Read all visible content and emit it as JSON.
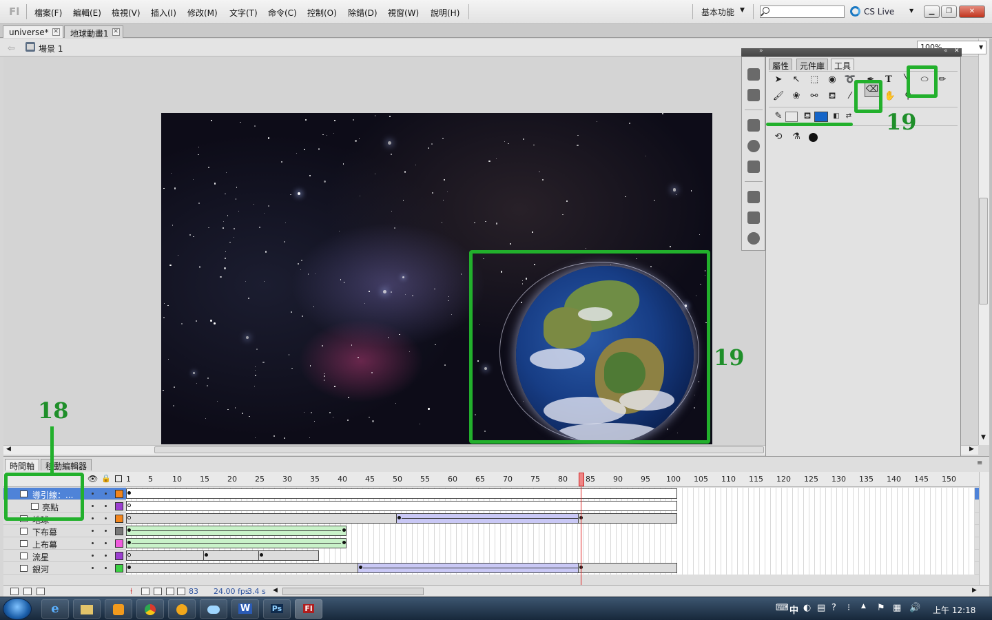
{
  "app": {
    "logo": "Fl"
  },
  "menus": [
    "檔案(F)",
    "編輯(E)",
    "檢視(V)",
    "插入(I)",
    "修改(M)",
    "文字(T)",
    "命令(C)",
    "控制(O)",
    "除錯(D)",
    "視窗(W)",
    "說明(H)"
  ],
  "workspace": {
    "label": "基本功能"
  },
  "search": {
    "placeholder": ""
  },
  "cs_live": "CS Live",
  "tabs": [
    {
      "label": "universe*"
    },
    {
      "label": "地球動畫1"
    }
  ],
  "editbar": {
    "scene_label": "場景 1",
    "zoom": "100%"
  },
  "panel": {
    "tabs": [
      "屬性",
      "元件庫",
      "工具"
    ],
    "active_tab": "工具",
    "text_tool_glyph": "T"
  },
  "annotations": {
    "layer_box_number": "18",
    "eraser_number": "19",
    "earth_box_number": "19",
    "color": "#22b02c"
  },
  "timeline": {
    "tabs": [
      "時間軸",
      "移動編輯器"
    ],
    "frame_labels": [
      "1",
      "5",
      "10",
      "15",
      "20",
      "25",
      "30",
      "35",
      "40",
      "45",
      "50",
      "55",
      "60",
      "65",
      "70",
      "75",
      "80",
      "85",
      "90",
      "95",
      "100",
      "105",
      "110",
      "115",
      "120",
      "125",
      "130",
      "135",
      "140",
      "145",
      "150"
    ],
    "current_frame": "83",
    "fps": "24.00 fps",
    "time": "3.4 s",
    "layers": [
      {
        "name": "導引線：...",
        "color": "#f2851c",
        "selected": true
      },
      {
        "name": "亮點",
        "color": "#9b3fd0"
      },
      {
        "name": "地球",
        "color": "#f2851c"
      },
      {
        "name": "下布幕",
        "color": "#777777"
      },
      {
        "name": "上布幕",
        "color": "#f05adc"
      },
      {
        "name": "流星",
        "color": "#9b3fd0"
      },
      {
        "name": "銀河",
        "color": "#3bd043"
      }
    ]
  },
  "taskbar": {
    "clock": "上午 12:18",
    "ime": "中",
    "apps": [
      "e",
      "",
      "",
      "",
      "",
      "",
      "W",
      "Ps",
      "Fl"
    ]
  }
}
